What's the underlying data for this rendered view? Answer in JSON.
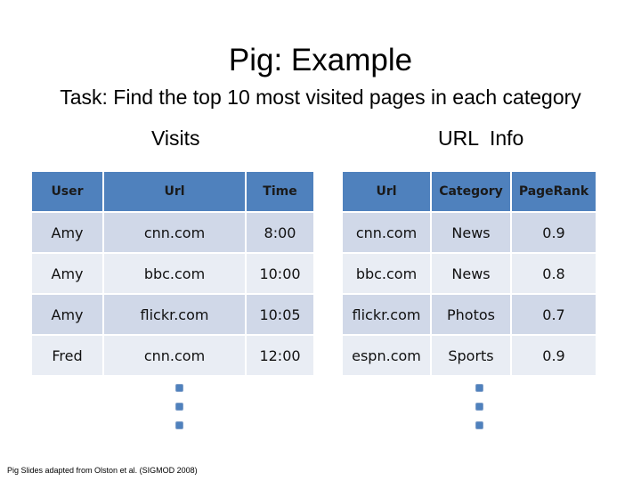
{
  "slide": {
    "title": "Pig: Example",
    "subtitle": "Task: Find the top 10 most visited pages in each category",
    "footer": "Pig Slides adapted from Olston et al. (SIGMOD 2008)"
  },
  "visits": {
    "label": "Visits",
    "headers": [
      "User",
      "Url",
      "Time"
    ],
    "rows": [
      [
        "Amy",
        "cnn.com",
        "8:00"
      ],
      [
        "Amy",
        "bbc.com",
        "10:00"
      ],
      [
        "Amy",
        "flickr.com",
        "10:05"
      ],
      [
        "Fred",
        "cnn.com",
        "12:00"
      ]
    ],
    "continuation_icon": "vertical-ellipsis-dots"
  },
  "url_info": {
    "label": "URL  Info",
    "headers": [
      "Url",
      "Category",
      "PageRank"
    ],
    "rows": [
      [
        "cnn.com",
        "News",
        "0.9"
      ],
      [
        "bbc.com",
        "News",
        "0.8"
      ],
      [
        "flickr.com",
        "Photos",
        "0.7"
      ],
      [
        "espn.com",
        "Sports",
        "0.9"
      ]
    ],
    "continuation_icon": "vertical-ellipsis-dots"
  },
  "colors": {
    "header_bg": "#4f81bd",
    "row_dark": "#d0d8e8",
    "row_light": "#e9edf4"
  }
}
